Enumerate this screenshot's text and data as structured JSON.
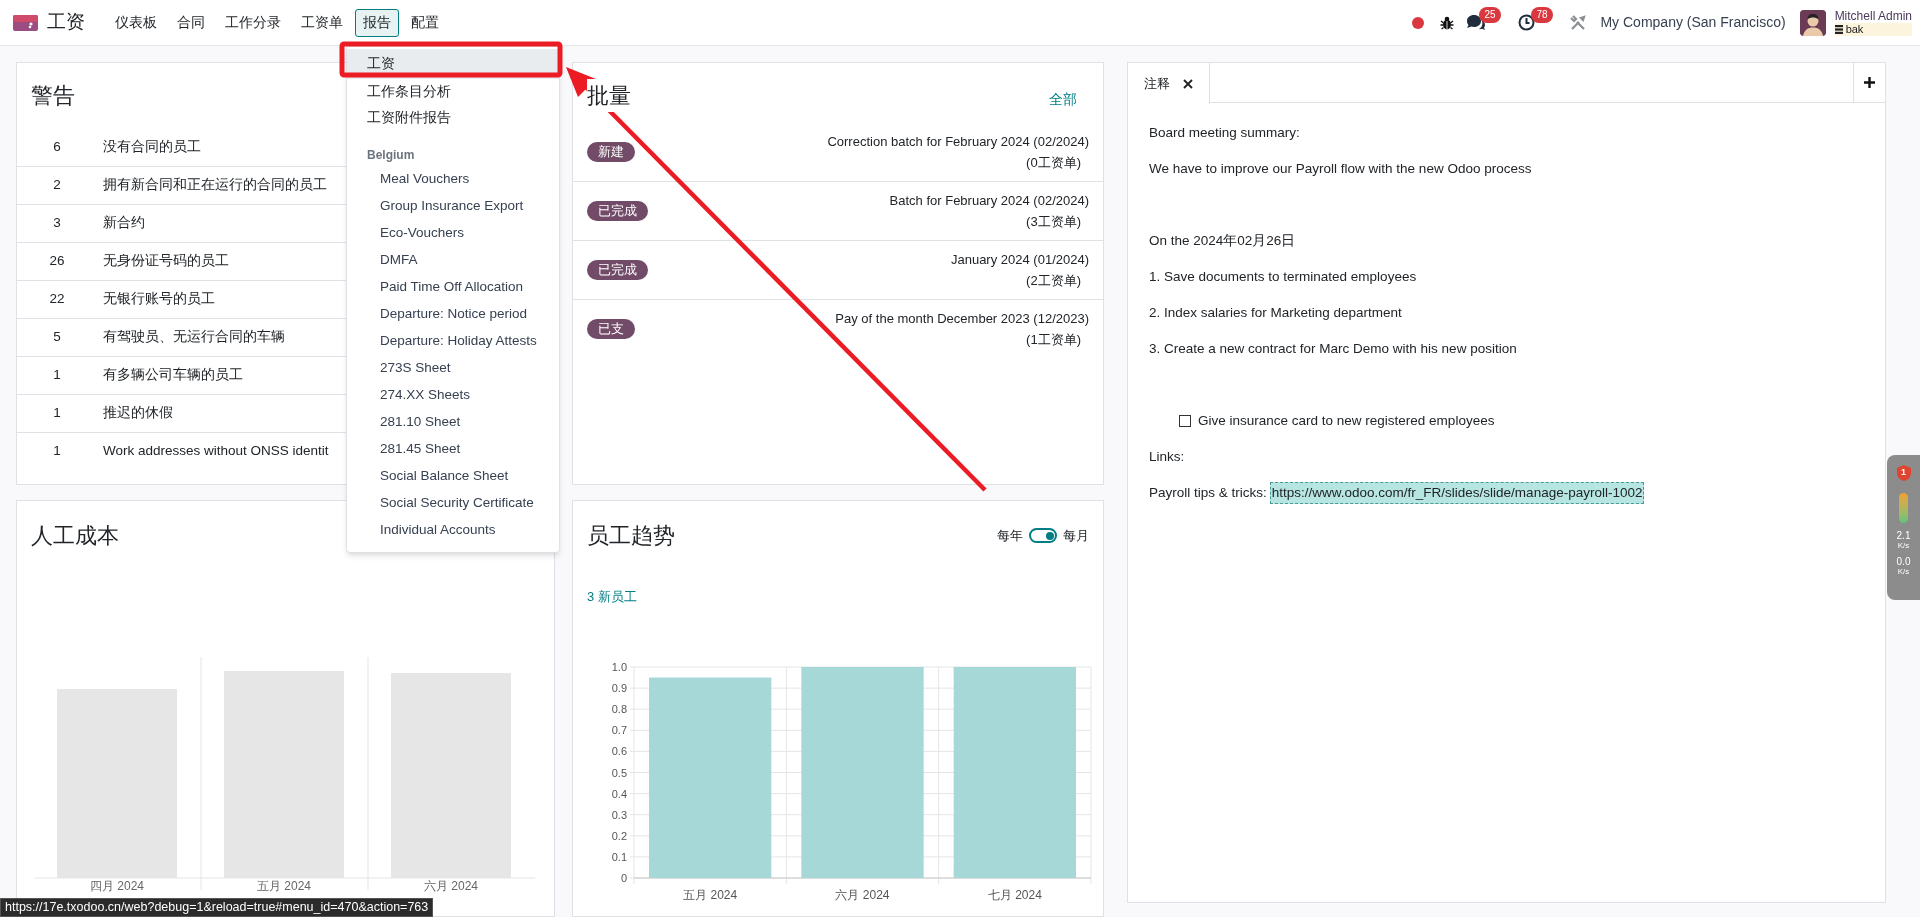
{
  "navbar": {
    "app_name": "工资",
    "menu": [
      {
        "label": "仪表板",
        "selected": false
      },
      {
        "label": "合同",
        "selected": false
      },
      {
        "label": "工作分录",
        "selected": false
      },
      {
        "label": "工资单",
        "selected": false
      },
      {
        "label": "报告",
        "selected": true
      },
      {
        "label": "配置",
        "selected": false
      }
    ],
    "notifications": [
      {
        "kind": "chat",
        "count": "25"
      },
      {
        "kind": "activity",
        "count": "78"
      }
    ],
    "company": "My Company (San Francisco)",
    "user": {
      "name": "Mitchell Admin",
      "database": "bak"
    }
  },
  "reporting_menu": {
    "items": [
      {
        "kind": "item",
        "label": "工资",
        "selected": true
      },
      {
        "kind": "item",
        "label": "工作条目分析",
        "selected": false
      },
      {
        "kind": "item",
        "label": "工资附件报告",
        "selected": false
      },
      {
        "kind": "header",
        "label": "Belgium"
      },
      {
        "kind": "subitem",
        "label": "Meal Vouchers",
        "selected": false
      },
      {
        "kind": "subitem",
        "label": "Group Insurance Export",
        "selected": false
      },
      {
        "kind": "subitem",
        "label": "Eco-Vouchers",
        "selected": false
      },
      {
        "kind": "subitem",
        "label": "DMFA",
        "selected": false
      },
      {
        "kind": "subitem",
        "label": "Paid Time Off Allocation",
        "selected": false
      },
      {
        "kind": "subitem",
        "label": "Departure: Notice period",
        "selected": false
      },
      {
        "kind": "subitem",
        "label": "Departure: Holiday Attests",
        "selected": false
      },
      {
        "kind": "subitem",
        "label": "273S Sheet",
        "selected": false
      },
      {
        "kind": "subitem",
        "label": "274.XX Sheets",
        "selected": false
      },
      {
        "kind": "subitem",
        "label": "281.10 Sheet",
        "selected": false
      },
      {
        "kind": "subitem",
        "label": "281.45 Sheet",
        "selected": false
      },
      {
        "kind": "subitem",
        "label": "Social Balance Sheet",
        "selected": false
      },
      {
        "kind": "subitem",
        "label": "Social Security Certificate",
        "selected": false
      },
      {
        "kind": "subitem",
        "label": "Individual Accounts",
        "selected": false
      }
    ]
  },
  "warnings": {
    "title": "警告",
    "rows": [
      {
        "count": "6",
        "label": "没有合同的员工"
      },
      {
        "count": "2",
        "label": "拥有新合同和正在运行的合同的员工"
      },
      {
        "count": "3",
        "label": "新合约"
      },
      {
        "count": "26",
        "label": "无身份证号码的员工"
      },
      {
        "count": "22",
        "label": "无银行账号的员工"
      },
      {
        "count": "5",
        "label": "有驾驶员、无运行合同的车辆"
      },
      {
        "count": "1",
        "label": "有多辆公司车辆的员工"
      },
      {
        "count": "1",
        "label": "推迟的休假"
      },
      {
        "count": "1",
        "label": "Work addresses without ONSS identit"
      }
    ]
  },
  "batches": {
    "title": "批量",
    "view_all": "全部",
    "rows": [
      {
        "status": "新建",
        "name": "Correction batch for February 2024 (02/2024)",
        "payslips": "(0工资单)"
      },
      {
        "status": "已完成",
        "name": "Batch for February 2024 (02/2024)",
        "payslips": "(3工资单)"
      },
      {
        "status": "已完成",
        "name": "January 2024 (01/2024)",
        "payslips": "(2工资单)"
      },
      {
        "status": "已支",
        "name": "Pay of the month December 2023 (12/2023)",
        "payslips": "(1工资单)"
      }
    ]
  },
  "labor_cost": {
    "title": "人工成本",
    "months": [
      "四月 2024",
      "五月 2024",
      "六月 2024"
    ]
  },
  "employee_trend": {
    "title": "员工趋势",
    "period_toggle": {
      "left_label": "每年",
      "right_label": "每月",
      "on": true
    },
    "new_employees": "3 新员工",
    "chart_data": {
      "type": "bar",
      "categories": [
        "五月 2024",
        "六月 2024",
        "七月 2024"
      ],
      "series": [
        {
          "color": "#a7d8d8",
          "values": [
            0.95,
            1,
            1
          ]
        }
      ],
      "grid": true,
      "ylim": [
        0,
        1
      ],
      "yticks": [
        0,
        0.1,
        0.2,
        0.3,
        0.4,
        0.5,
        0.6,
        0.7,
        0.8,
        0.9,
        {
          "value": 1,
          "label": "1.0"
        }
      ]
    }
  },
  "notes": {
    "tabs": [
      {
        "label": "注释",
        "selected": true
      }
    ],
    "lines": [
      {
        "kind": "text",
        "text": "Board meeting summary:"
      },
      {
        "kind": "text",
        "text": "We have to improve our Payroll flow with the new Odoo process"
      },
      {
        "kind": "spacer"
      },
      {
        "kind": "text",
        "text": "On the 2024年02月26日"
      },
      {
        "kind": "text",
        "text": "1. Save documents to terminated employees"
      },
      {
        "kind": "text",
        "text": "2. Index salaries for Marketing department"
      },
      {
        "kind": "text",
        "text": "3. Create a new contract for Marc Demo with his new position"
      },
      {
        "kind": "spacer"
      },
      {
        "kind": "checkbox",
        "text": "Give insurance card to new registered employees",
        "checked": false
      },
      {
        "kind": "text",
        "text": "Links:"
      },
      {
        "kind": "link",
        "text": "Payroll tips & tricks:",
        "url": "https://www.odoo.com/fr_FR/slides/slide/manage-payroll-1002"
      }
    ]
  },
  "side_widget": {
    "alerts": "1",
    "upload": "2.1",
    "upload_unit": "K/s",
    "download": "0.0",
    "download_unit": "K/s"
  },
  "status_url": "https://17e.txodoo.cn/web?debug=1&reload=true#menu_id=470&action=763"
}
